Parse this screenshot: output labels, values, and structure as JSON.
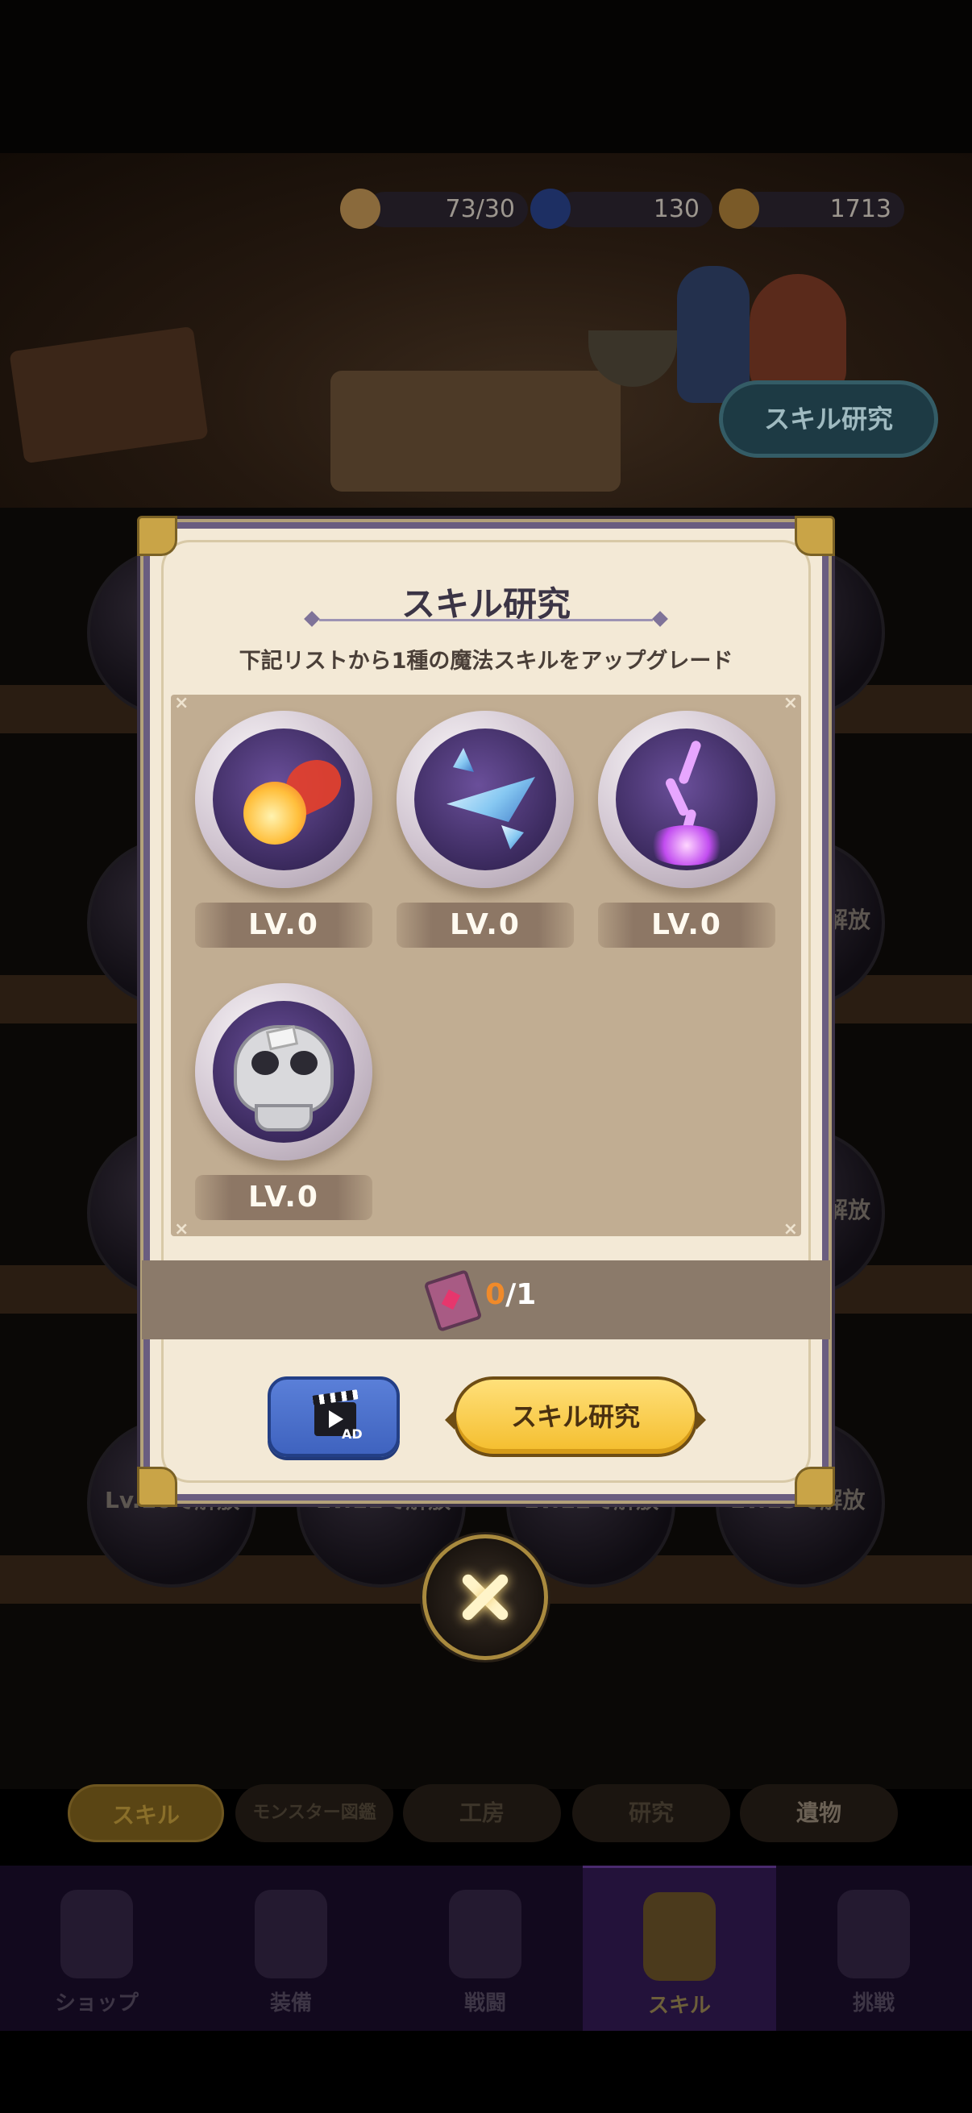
{
  "background": {
    "resources": [
      {
        "icon": "sandwich-icon",
        "value": "73/30"
      },
      {
        "icon": "moon-icon",
        "value": "130"
      },
      {
        "icon": "coin-icon",
        "value": "1713"
      }
    ],
    "research_button_label": "スキル研究",
    "locked_slots": [
      {
        "label": "Lv.10で解放"
      },
      {
        "label": "Lv.11で解放"
      },
      {
        "label": "Lv.12で解放"
      },
      {
        "label": "Lv.13で解放"
      }
    ],
    "side_labels": [
      "解放",
      "解放"
    ],
    "tabs": [
      {
        "label": "スキル",
        "locked": false
      },
      {
        "label": "モンスター図鑑",
        "locked": true
      },
      {
        "label": "工房",
        "locked": true
      },
      {
        "label": "研究",
        "locked": true
      },
      {
        "label": "遺物",
        "locked": false
      }
    ],
    "bottom_nav": [
      {
        "label": "ショップ",
        "icon": "shop-icon",
        "locked": true
      },
      {
        "label": "装備",
        "icon": "equipment-icon",
        "locked": false
      },
      {
        "label": "戦闘",
        "icon": "battle-icon",
        "locked": false
      },
      {
        "label": "スキル",
        "icon": "skill-book-icon",
        "locked": false,
        "active": true
      },
      {
        "label": "挑戦",
        "icon": "challenge-icon",
        "locked": true
      }
    ]
  },
  "dialog": {
    "title": "スキル研究",
    "subtitle": "下記リストから1種の魔法スキルをアップグレード",
    "skills": [
      {
        "icon": "fireball-skill-icon",
        "level": "LV.0"
      },
      {
        "icon": "ice-shard-skill-icon",
        "level": "LV.0"
      },
      {
        "icon": "lightning-skill-icon",
        "level": "LV.0"
      },
      {
        "icon": "skull-skill-icon",
        "level": "LV.0"
      }
    ],
    "cost": {
      "icon": "spellbook-icon",
      "owned": "0",
      "separator_required": "/1"
    },
    "ad_button": {
      "icon": "video-ad-icon",
      "label": "AD"
    },
    "research_button_label": "スキル研究",
    "close_icon": "close-icon"
  },
  "colors": {
    "dialog_bg": "#f3e9d6",
    "panel_bg": "#c1ad92",
    "research_button": "#f4bd2c",
    "ad_button": "#3f63bf",
    "cost_owned": "#f08a2a"
  }
}
